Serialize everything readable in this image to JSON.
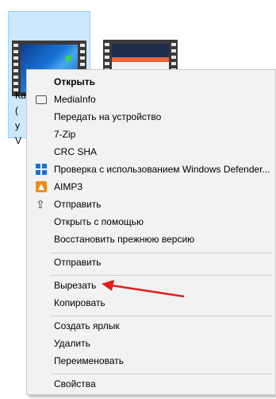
{
  "files": [
    {
      "label": "Ка\n(\nу\nV"
    },
    {
      "label": ""
    }
  ],
  "menu": {
    "items": [
      {
        "label": "Открыть",
        "bold": true,
        "icon": ""
      },
      {
        "label": "MediaInfo",
        "icon": "mediainfo-icon"
      },
      {
        "label": "Передать на устройство",
        "icon": ""
      },
      {
        "label": "7-Zip",
        "icon": ""
      },
      {
        "label": "CRC SHA",
        "icon": ""
      },
      {
        "label": "Проверка с использованием Windows Defender...",
        "icon": "windows-defender-icon"
      },
      {
        "label": "AIMP3",
        "icon": "aimp-icon"
      },
      {
        "label": "Отправить",
        "icon": "share-icon"
      },
      {
        "label": "Открыть с помощью",
        "icon": ""
      },
      {
        "label": "Восстановить прежнюю версию",
        "icon": ""
      },
      {
        "label": "Отправить",
        "icon": ""
      },
      {
        "label": "Вырезать",
        "icon": ""
      },
      {
        "label": "Копировать",
        "icon": ""
      },
      {
        "label": "Создать ярлык",
        "icon": ""
      },
      {
        "label": "Удалить",
        "icon": ""
      },
      {
        "label": "Переименовать",
        "icon": ""
      },
      {
        "label": "Свойства",
        "icon": ""
      }
    ],
    "share_glyph": "⇪",
    "colors": {
      "menu_bg": "#f2f2f2",
      "selection_bg": "#cce8ff",
      "annotation_arrow": "#e02020",
      "defender_blue": "#1e6fd0",
      "aimp_orange": "#f28b1c"
    }
  }
}
